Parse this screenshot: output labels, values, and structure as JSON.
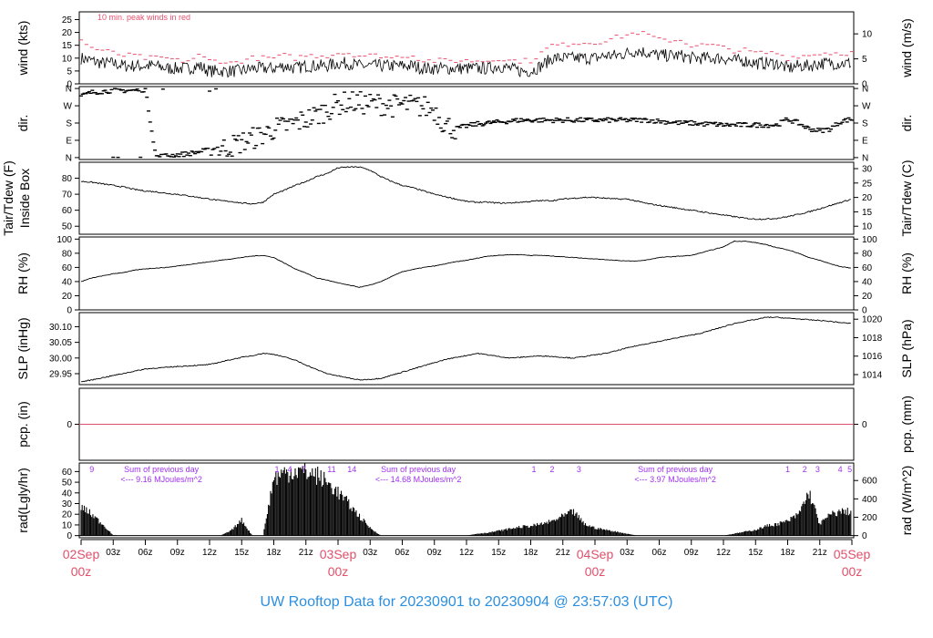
{
  "title": "UW Rooftop Data for 20230901  to  20230904 @ 23:57:03  (UTC)",
  "colors": {
    "title": "#2b8fe0",
    "day_label": "#e0506a",
    "peak": "#e8506e",
    "annotation": "#a030f0",
    "line": "#000000",
    "zero_line": "#e0506a"
  },
  "chart_data": {
    "type": "line",
    "x": {
      "unit": "hours since 02Sep 00z",
      "range": [
        0,
        72
      ],
      "step": 1,
      "tick_labels": [
        {
          "h": 0,
          "top": "02Sep",
          "bottom": "00z",
          "day": true
        },
        {
          "h": 3,
          "top": "03z"
        },
        {
          "h": 6,
          "top": "06z"
        },
        {
          "h": 9,
          "top": "09z"
        },
        {
          "h": 12,
          "top": "12z"
        },
        {
          "h": 15,
          "top": "15z"
        },
        {
          "h": 18,
          "top": "18z"
        },
        {
          "h": 21,
          "top": "21z"
        },
        {
          "h": 24,
          "top": "03Sep",
          "bottom": "00z",
          "day": true
        },
        {
          "h": 27,
          "top": "03z"
        },
        {
          "h": 30,
          "top": "06z"
        },
        {
          "h": 33,
          "top": "09z"
        },
        {
          "h": 36,
          "top": "12z"
        },
        {
          "h": 39,
          "top": "15z"
        },
        {
          "h": 42,
          "top": "18z"
        },
        {
          "h": 45,
          "top": "21z"
        },
        {
          "h": 48,
          "top": "04Sep",
          "bottom": "00z",
          "day": true
        },
        {
          "h": 51,
          "top": "03z"
        },
        {
          "h": 54,
          "top": "06z"
        },
        {
          "h": 57,
          "top": "09z"
        },
        {
          "h": 60,
          "top": "12z"
        },
        {
          "h": 63,
          "top": "15z"
        },
        {
          "h": 66,
          "top": "18z"
        },
        {
          "h": 69,
          "top": "21z"
        },
        {
          "h": 72,
          "top": "05Sep",
          "bottom": "00z",
          "day": true
        }
      ]
    },
    "panels": [
      {
        "id": "wind",
        "ylabel": "wind (kts)",
        "ylabel_right": "wind (m/s)",
        "ylim": [
          0,
          28
        ],
        "yticks": [
          0,
          5,
          10,
          15,
          20,
          25
        ],
        "yticks_right": [
          {
            "v": 0,
            "label": "0"
          },
          {
            "v": 9.72,
            "label": "5"
          },
          {
            "v": 19.44,
            "label": "10"
          }
        ],
        "annotation": "10 min. peak winds in red",
        "values": [
          10,
          9,
          8,
          8,
          7,
          7,
          7,
          7,
          6,
          6,
          6,
          7,
          5,
          5,
          5,
          5,
          6,
          6,
          6,
          7,
          6,
          7,
          7,
          7,
          8,
          8,
          7,
          7,
          7,
          7,
          7,
          7,
          6,
          6,
          6,
          6,
          6,
          6,
          6,
          7,
          6,
          5,
          5,
          7,
          10,
          10,
          10,
          10,
          10,
          11,
          11,
          12,
          13,
          12,
          11,
          11,
          11,
          10,
          10,
          10,
          10,
          9,
          9,
          8,
          8,
          8,
          6,
          7,
          7,
          8,
          8,
          8,
          8
        ],
        "peak": [
          17,
          14,
          13,
          12,
          11,
          11,
          10,
          10,
          10,
          9,
          9,
          11,
          9,
          9,
          8,
          9,
          10,
          10,
          10,
          11,
          10,
          11,
          11,
          11,
          12,
          12,
          11,
          11,
          11,
          10,
          11,
          11,
          9,
          9,
          9,
          9,
          9,
          9,
          9,
          10,
          9,
          9,
          9,
          12,
          15,
          15,
          16,
          16,
          16,
          17,
          18,
          19,
          20,
          19,
          17,
          17,
          17,
          15,
          15,
          15,
          14,
          13,
          13,
          12,
          12,
          12,
          10,
          11,
          11,
          12,
          12,
          12,
          12
        ]
      },
      {
        "id": "dir",
        "ylabel": "dir.",
        "ylabel_right": "dir.",
        "ylim": [
          -10,
          370
        ],
        "yticks": [
          {
            "v": 0,
            "label": "N"
          },
          {
            "v": 90,
            "label": "E"
          },
          {
            "v": 180,
            "label": "S"
          },
          {
            "v": 270,
            "label": "W"
          },
          {
            "v": 360,
            "label": "N"
          }
        ],
        "values": [
          320,
          340,
          345,
          350,
          350,
          350,
          355,
          5,
          10,
          15,
          20,
          30,
          40,
          45,
          60,
          80,
          100,
          120,
          150,
          160,
          180,
          200,
          220,
          250,
          280,
          290,
          285,
          280,
          280,
          270,
          275,
          270,
          265,
          250,
          170,
          150,
          165,
          175,
          180,
          185,
          190,
          195,
          195,
          195,
          195,
          195,
          195,
          195,
          195,
          195,
          195,
          195,
          195,
          195,
          190,
          185,
          180,
          180,
          175,
          175,
          170,
          170,
          170,
          170,
          170,
          170,
          200,
          180,
          150,
          140,
          150,
          190,
          200
        ]
      },
      {
        "id": "temp",
        "ylabel": "Tair/Tdew (F)",
        "ylabel2": "Inside Box",
        "ylabel_right": "Tair/Tdew (C)",
        "ylim": [
          45,
          90
        ],
        "yticks": [
          50,
          60,
          70,
          80
        ],
        "yticks_right": [
          {
            "v": 50,
            "label": "10"
          },
          {
            "v": 59,
            "label": "15"
          },
          {
            "v": 68,
            "label": "20"
          },
          {
            "v": 77,
            "label": "25"
          },
          {
            "v": 86,
            "label": "30"
          }
        ],
        "values": [
          78,
          77.5,
          76.5,
          75.5,
          74.5,
          73,
          72,
          71.5,
          70.5,
          70,
          69,
          68,
          67,
          66,
          65.5,
          64.5,
          64,
          65,
          70,
          72.5,
          75.5,
          78,
          81,
          83,
          86.5,
          87,
          87,
          85,
          81,
          78,
          75.5,
          74,
          72,
          70,
          68.5,
          67,
          65.5,
          65,
          65,
          64.5,
          64.5,
          65,
          65.5,
          66,
          66,
          67,
          67.5,
          68,
          68,
          67.5,
          67,
          67,
          65.5,
          64,
          63,
          62,
          61,
          60,
          59,
          58,
          57,
          56,
          55,
          54.5,
          54.5,
          55,
          56,
          57.5,
          59,
          61,
          63,
          65,
          67
        ]
      },
      {
        "id": "rh",
        "ylabel": "RH (%)",
        "ylabel_right": "RH (%)",
        "ylim": [
          0,
          103
        ],
        "yticks": [
          0,
          20,
          40,
          60,
          80,
          100
        ],
        "yticks_right": [
          {
            "v": 0,
            "label": "0"
          },
          {
            "v": 20,
            "label": "20"
          },
          {
            "v": 40,
            "label": "40"
          },
          {
            "v": 60,
            "label": "60"
          },
          {
            "v": 80,
            "label": "80"
          },
          {
            "v": 100,
            "label": "100"
          }
        ],
        "values": [
          40,
          45,
          48,
          51,
          53,
          56,
          58,
          59,
          60,
          62,
          64,
          66,
          68,
          70,
          72,
          74,
          76,
          77,
          74,
          66,
          58,
          52,
          45,
          42,
          38,
          35,
          32,
          35,
          40,
          47,
          54,
          57,
          60,
          62,
          65,
          68,
          70,
          73,
          76,
          77,
          78,
          78,
          77,
          77,
          76,
          75,
          74,
          73,
          72,
          71,
          70,
          69,
          69,
          71,
          74,
          75,
          76,
          77,
          81,
          85,
          89,
          97,
          97,
          95,
          92,
          88,
          85,
          80,
          74,
          70,
          65,
          61,
          59
        ]
      },
      {
        "id": "slp",
        "ylabel": "SLP (inHg)",
        "ylabel_right": "SLP (hPa)",
        "ylim": [
          29.915,
          30.145
        ],
        "yticks": [
          29.95,
          30.0,
          30.05,
          30.1
        ],
        "yticks_right": [
          {
            "v": 29.947,
            "label": "1014"
          },
          {
            "v": 30.006,
            "label": "1016"
          },
          {
            "v": 30.065,
            "label": "1018"
          },
          {
            "v": 30.124,
            "label": "1020"
          }
        ],
        "values": [
          29.924,
          29.93,
          29.937,
          29.944,
          29.951,
          29.958,
          29.965,
          29.968,
          29.97,
          29.973,
          29.975,
          29.977,
          29.979,
          29.987,
          29.995,
          30.002,
          30.008,
          30.015,
          30.012,
          30.003,
          29.993,
          29.978,
          29.963,
          29.95,
          29.943,
          29.936,
          29.93,
          29.932,
          29.935,
          29.945,
          29.955,
          29.965,
          29.975,
          29.985,
          29.995,
          30.002,
          30.008,
          30.015,
          30.01,
          30.005,
          30.0,
          30.002,
          30.005,
          30.007,
          30.005,
          30.002,
          30.0,
          30.005,
          30.01,
          30.015,
          30.023,
          30.032,
          30.04,
          30.047,
          30.053,
          30.06,
          30.067,
          30.073,
          30.08,
          30.09,
          30.1,
          30.11,
          30.117,
          30.123,
          30.13,
          30.13,
          30.127,
          30.125,
          30.122,
          30.12,
          30.117,
          30.113,
          30.11
        ]
      },
      {
        "id": "pcp",
        "ylabel": "pcp. (in)",
        "ylabel_right": "pcp. (mm)",
        "ylim": [
          -1,
          1
        ],
        "yticks": [
          0
        ],
        "yticks_right": [
          {
            "v": 0,
            "label": "0"
          }
        ],
        "values": [
          0,
          0
        ]
      },
      {
        "id": "rad",
        "type": "bar",
        "ylabel": "rad(Lgly/hr)",
        "ylabel_right": "rad (W/m^2)",
        "ylim": [
          -2,
          68
        ],
        "yticks": [
          0,
          10,
          20,
          30,
          40,
          50,
          60
        ],
        "yticks_right": [
          {
            "v": 0,
            "label": "0"
          },
          {
            "v": 17.2,
            "label": "200"
          },
          {
            "v": 34.4,
            "label": "400"
          },
          {
            "v": 51.6,
            "label": "600"
          }
        ],
        "values": [
          30,
          22,
          12,
          0.5,
          0,
          0,
          0,
          0,
          0,
          0,
          0,
          0,
          0,
          0,
          5,
          16,
          0,
          0,
          60,
          65,
          68,
          66,
          63,
          55,
          45,
          33,
          20,
          8,
          0,
          0,
          0,
          0,
          0,
          0,
          0,
          0,
          0,
          2,
          3,
          5,
          7,
          9,
          10,
          12,
          15,
          20,
          25,
          12,
          8,
          6,
          4,
          2,
          0,
          0,
          0,
          0,
          0,
          0,
          0,
          0,
          0,
          2,
          4,
          6,
          10,
          12,
          15,
          22,
          45,
          12,
          22,
          25,
          25
        ],
        "annotations": [
          {
            "h": 1,
            "text": "9"
          },
          {
            "h": 18.3,
            "text": "1"
          },
          {
            "h": 19.5,
            "text": "4"
          },
          {
            "h": 20.8,
            "text": "7"
          },
          {
            "h": 23.4,
            "text": "11"
          },
          {
            "h": 25.3,
            "text": "14"
          },
          {
            "h": 42.3,
            "text": "1"
          },
          {
            "h": 44,
            "text": "2"
          },
          {
            "h": 46.5,
            "text": "3"
          },
          {
            "h": 66,
            "text": "1"
          },
          {
            "h": 67.6,
            "text": "2"
          },
          {
            "h": 68.8,
            "text": "3"
          },
          {
            "h": 70.9,
            "text": "4"
          },
          {
            "h": 71.8,
            "text": "5"
          }
        ],
        "daily_sums": [
          {
            "h": 7.5,
            "line1": "Sum of previous day",
            "line2": "<--- 9.16 MJoules/m^2"
          },
          {
            "h": 31.5,
            "line1": "Sum of previous day",
            "line2": "<--- 14.68 MJoules/m^2"
          },
          {
            "h": 55.5,
            "line1": "Sum of previous day",
            "line2": "<--- 3.97 MJoules/m^2"
          }
        ]
      }
    ]
  }
}
